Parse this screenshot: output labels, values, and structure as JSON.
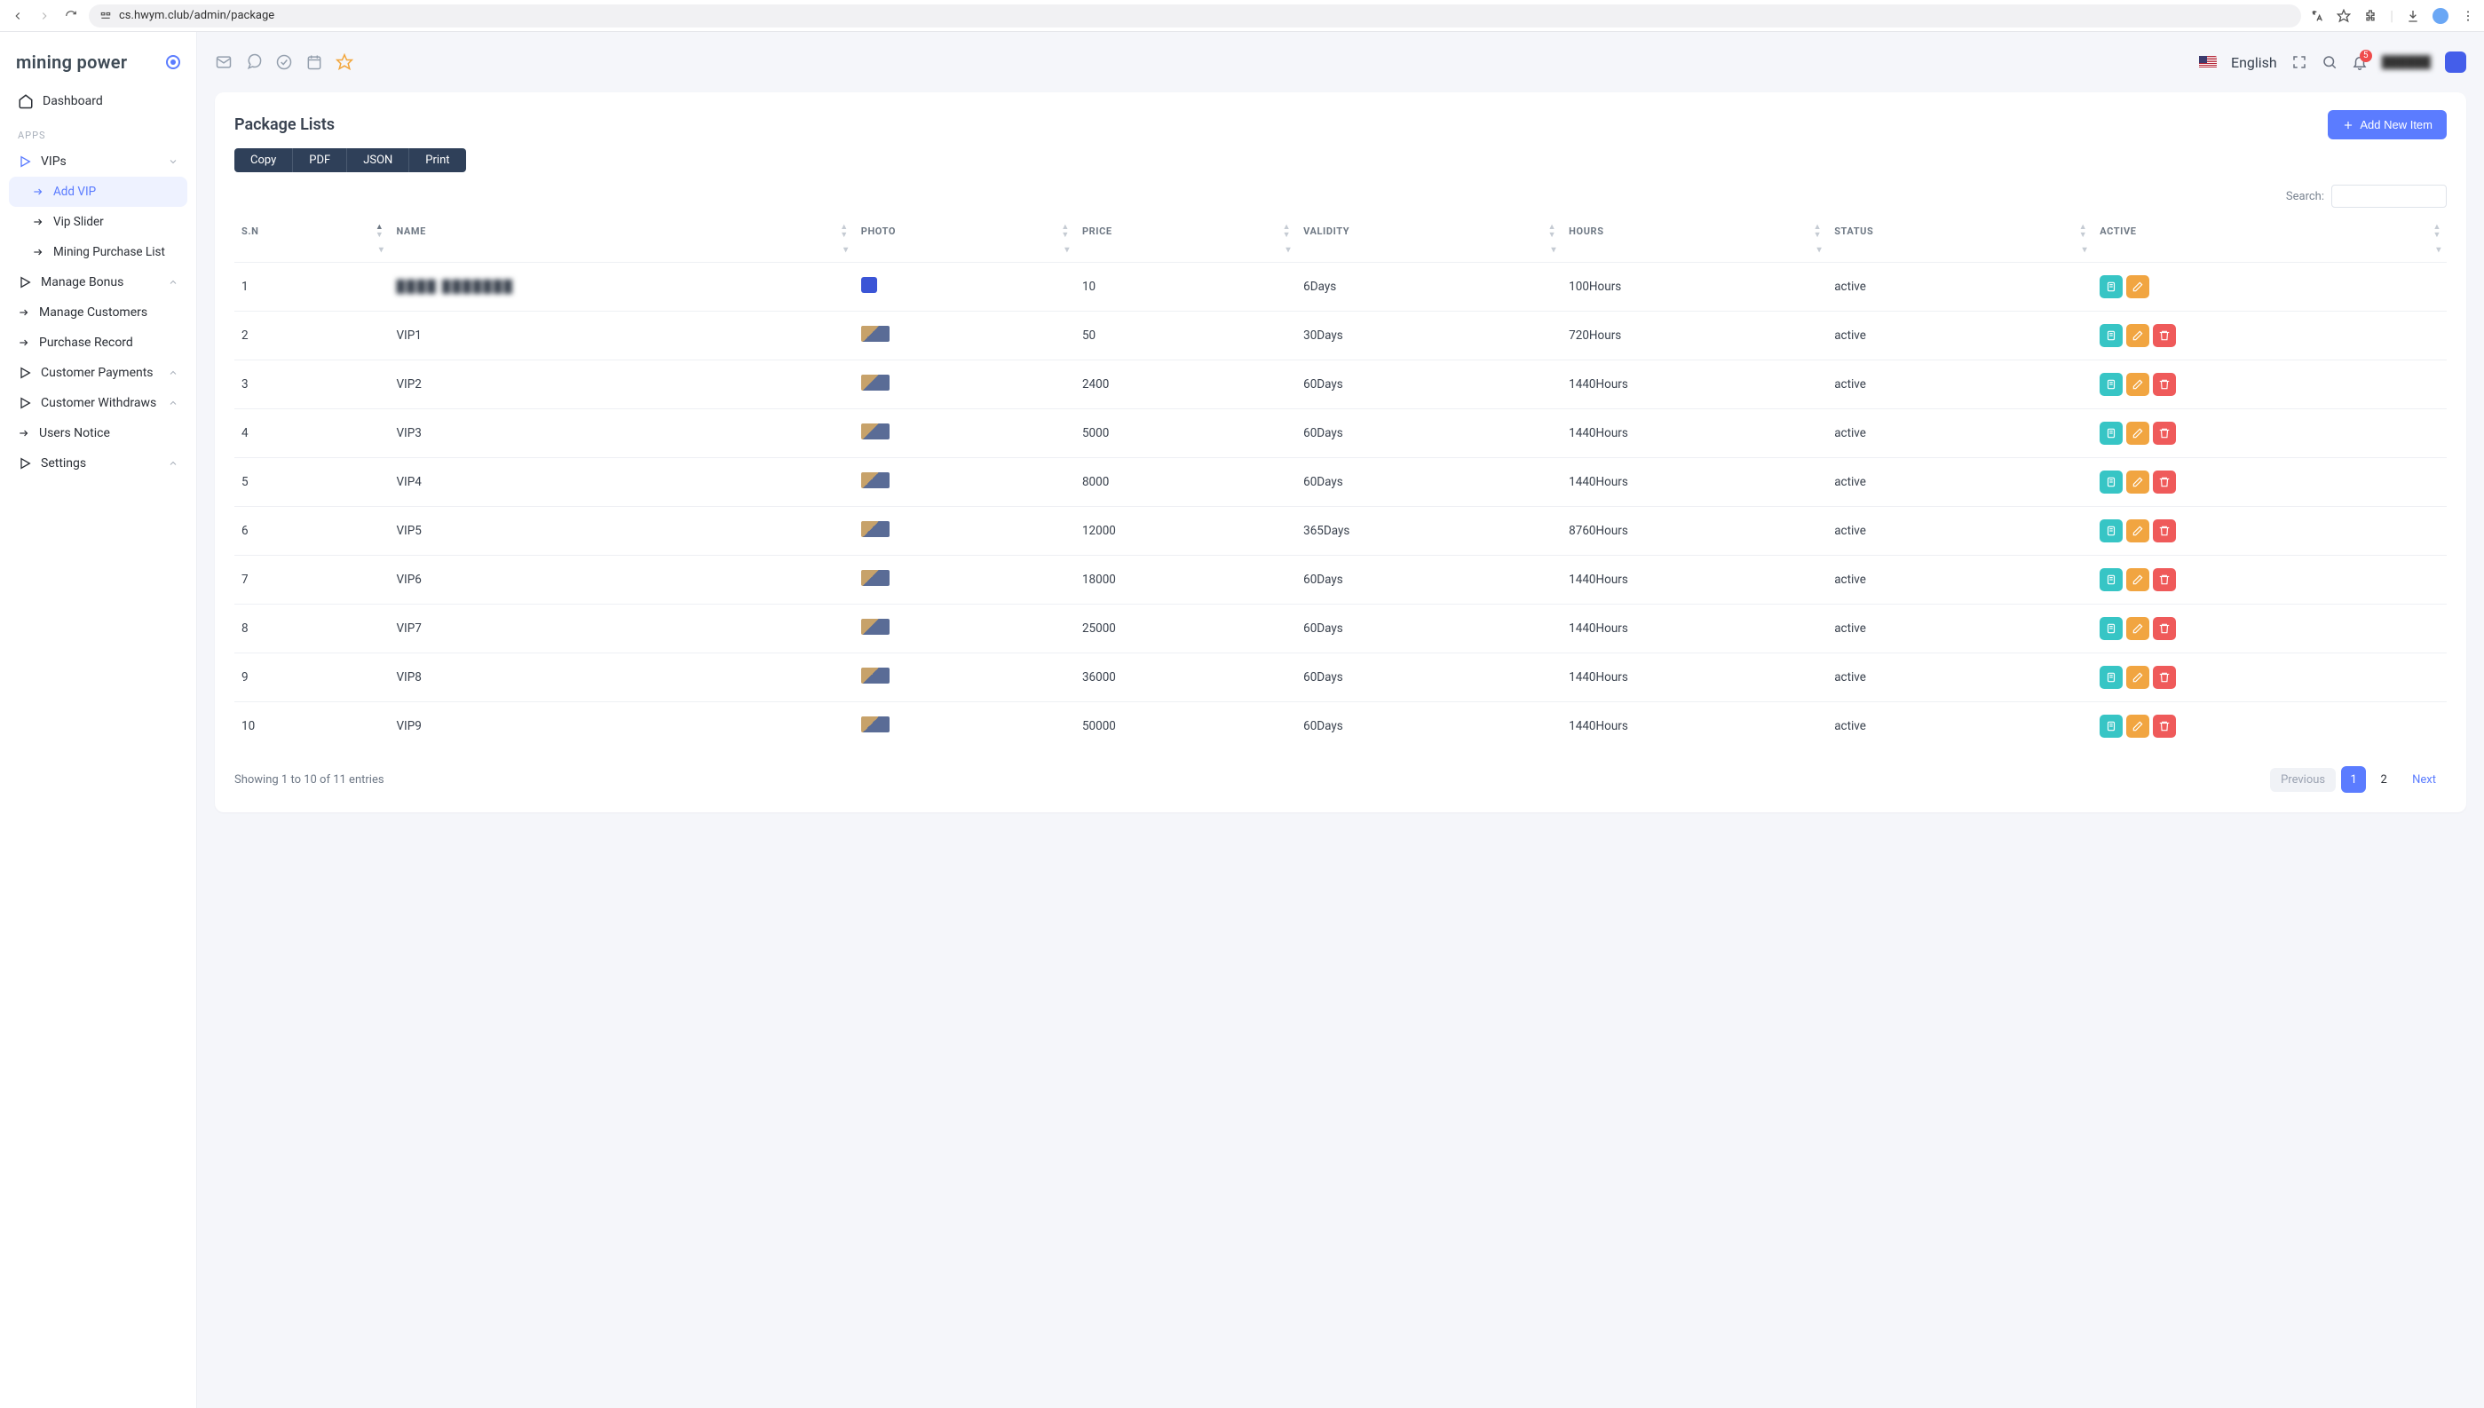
{
  "browser": {
    "url": "cs.hwym.club/admin/package"
  },
  "brand": "mining power",
  "sidebar": {
    "dashboard": "Dashboard",
    "appsLabel": "APPS",
    "vips": "VIPs",
    "addVip": "Add VIP",
    "vipSlider": "Vip Slider",
    "miningPurchase": "Mining Purchase List",
    "manageBonus": "Manage Bonus",
    "manageCustomers": "Manage Customers",
    "purchaseRecord": "Purchase Record",
    "customerPayments": "Customer Payments",
    "customerWithdraws": "Customer Withdraws",
    "usersNotice": "Users Notice",
    "settings": "Settings"
  },
  "topbar": {
    "language": "English",
    "notifCount": "5"
  },
  "card": {
    "title": "Package Lists",
    "addBtn": "Add New Item",
    "export": {
      "copy": "Copy",
      "pdf": "PDF",
      "json": "JSON",
      "print": "Print"
    },
    "searchLabel": "Search:"
  },
  "table": {
    "headers": {
      "sn": "S.N",
      "name": "NAME",
      "photo": "PHOTO",
      "price": "PRICE",
      "validity": "VALIDITY",
      "hours": "HOURS",
      "status": "STATUS",
      "active": "ACTIVE"
    },
    "rows": [
      {
        "sn": "1",
        "name": "████ ███████",
        "price": "10",
        "validity": "6Days",
        "hours": "100Hours",
        "status": "active",
        "blur": true,
        "logo": true,
        "hasDelete": false
      },
      {
        "sn": "2",
        "name": "VIP1",
        "price": "50",
        "validity": "30Days",
        "hours": "720Hours",
        "status": "active",
        "hasDelete": true
      },
      {
        "sn": "3",
        "name": "VIP2",
        "price": "2400",
        "validity": "60Days",
        "hours": "1440Hours",
        "status": "active",
        "hasDelete": true
      },
      {
        "sn": "4",
        "name": "VIP3",
        "price": "5000",
        "validity": "60Days",
        "hours": "1440Hours",
        "status": "active",
        "hasDelete": true
      },
      {
        "sn": "5",
        "name": "VIP4",
        "price": "8000",
        "validity": "60Days",
        "hours": "1440Hours",
        "status": "active",
        "hasDelete": true
      },
      {
        "sn": "6",
        "name": "VIP5",
        "price": "12000",
        "validity": "365Days",
        "hours": "8760Hours",
        "status": "active",
        "hasDelete": true
      },
      {
        "sn": "7",
        "name": "VIP6",
        "price": "18000",
        "validity": "60Days",
        "hours": "1440Hours",
        "status": "active",
        "hasDelete": true
      },
      {
        "sn": "8",
        "name": "VIP7",
        "price": "25000",
        "validity": "60Days",
        "hours": "1440Hours",
        "status": "active",
        "hasDelete": true
      },
      {
        "sn": "9",
        "name": "VIP8",
        "price": "36000",
        "validity": "60Days",
        "hours": "1440Hours",
        "status": "active",
        "hasDelete": true
      },
      {
        "sn": "10",
        "name": "VIP9",
        "price": "50000",
        "validity": "60Days",
        "hours": "1440Hours",
        "status": "active",
        "hasDelete": true
      }
    ],
    "entriesInfo": "Showing 1 to 10 of 11 entries",
    "pagination": {
      "prev": "Previous",
      "p1": "1",
      "p2": "2",
      "next": "Next"
    }
  }
}
